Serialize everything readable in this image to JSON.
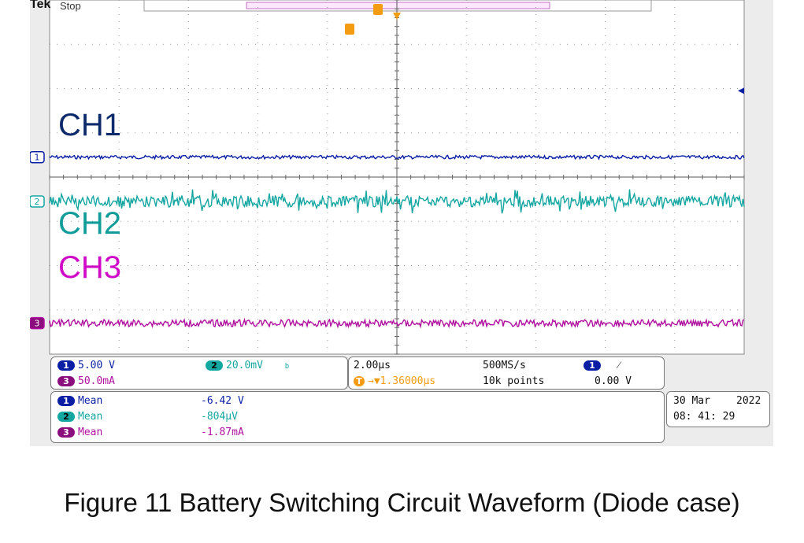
{
  "header": {
    "brand": "Tek",
    "status": "Stop"
  },
  "colors": {
    "ch1": "#0a1fa3",
    "ch2": "#14a6a0",
    "ch3": "#b0109e",
    "trigger": "#f39c12",
    "grid": "#9a9a9a",
    "label1": "#0d2a6b",
    "label2": "#139d9a",
    "label3": "#d00bc8"
  },
  "chart_data": {
    "type": "line",
    "title": "",
    "x_range_divisions": [
      -5,
      5
    ],
    "y_range_divisions": [
      -4,
      4
    ],
    "timebase": "2.00µs",
    "series": [
      {
        "name": "CH1",
        "marker": "1",
        "level_div": 0.45,
        "noise": "low",
        "scale": "5.00 V",
        "mean": "-6.42 V"
      },
      {
        "name": "CH2",
        "marker": "2",
        "level_div": -0.55,
        "noise": "high",
        "scale": "20.0mV",
        "mean": "-804µV"
      },
      {
        "name": "CH3",
        "marker": "3",
        "level_div": -3.3,
        "noise": "medium",
        "scale": "50.0mA",
        "mean": "-1.87mA"
      }
    ]
  },
  "readouts": {
    "ch1_scale": "5.00 V",
    "ch2_scale": "20.0mV",
    "ch3_scale": "50.0mA",
    "bw_mark": "b",
    "timebase": "2.00µs",
    "trigger_delay": "→▼1.36000µs",
    "sample_rate": "500MS/s",
    "record_length": "10k points",
    "trigger_source": "1",
    "trigger_slope": "⁄",
    "trigger_level": "0.00 V",
    "mean_label": "Mean",
    "ch1_mean": "-6.42 V",
    "ch2_mean": "-804µV",
    "ch3_mean": "-1.87mA",
    "date": "30 Mar",
    "year": "2022",
    "time": "08: 41: 29"
  },
  "caption": "Figure 11 Battery Switching Circuit Waveform (Diode case)"
}
